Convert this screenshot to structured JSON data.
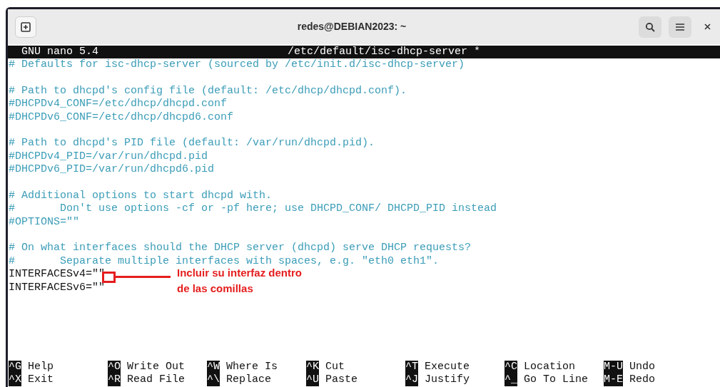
{
  "window": {
    "title": "redes@DEBIAN2023: ~"
  },
  "nano": {
    "version": "GNU nano 5.4",
    "filename": "/etc/default/isc-dhcp-server *"
  },
  "lines": [
    {
      "kind": "comment",
      "text": "# Defaults for isc-dhcp-server (sourced by /etc/init.d/isc-dhcp-server)"
    },
    {
      "kind": "blank"
    },
    {
      "kind": "comment",
      "text": "# Path to dhcpd's config file (default: /etc/dhcp/dhcpd.conf)."
    },
    {
      "kind": "comment",
      "text": "#DHCPDv4_CONF=/etc/dhcp/dhcpd.conf"
    },
    {
      "kind": "comment",
      "text": "#DHCPDv6_CONF=/etc/dhcp/dhcpd6.conf"
    },
    {
      "kind": "blank"
    },
    {
      "kind": "comment",
      "text": "# Path to dhcpd's PID file (default: /var/run/dhcpd.pid)."
    },
    {
      "kind": "comment",
      "text": "#DHCPDv4_PID=/var/run/dhcpd.pid"
    },
    {
      "kind": "comment",
      "text": "#DHCPDv6_PID=/var/run/dhcpd6.pid"
    },
    {
      "kind": "blank"
    },
    {
      "kind": "comment",
      "text": "# Additional options to start dhcpd with."
    },
    {
      "kind": "comment",
      "text": "#       Don't use options -cf or -pf here; use DHCPD_CONF/ DHCPD_PID instead"
    },
    {
      "kind": "comment",
      "text": "#OPTIONS=\"\""
    },
    {
      "kind": "blank"
    },
    {
      "kind": "comment",
      "text": "# On what interfaces should the DHCP server (dhcpd) serve DHCP requests?"
    },
    {
      "kind": "comment",
      "text": "#       Separate multiple interfaces with spaces, e.g. \"eth0 eth1\"."
    },
    {
      "kind": "code",
      "text": "INTERFACESv4=\"\""
    },
    {
      "kind": "code",
      "text": "INTERFACESv6=\"\""
    }
  ],
  "annotation": {
    "lines": [
      "Incluir su interfaz dentro",
      "de las comillas"
    ]
  },
  "shortcuts": [
    {
      "key": "^G",
      "label": "Help"
    },
    {
      "key": "^X",
      "label": "Exit"
    },
    {
      "key": "^O",
      "label": "Write Out"
    },
    {
      "key": "^R",
      "label": "Read File"
    },
    {
      "key": "^W",
      "label": "Where Is"
    },
    {
      "key": "^\\",
      "label": "Replace"
    },
    {
      "key": "^K",
      "label": "Cut"
    },
    {
      "key": "^U",
      "label": "Paste"
    },
    {
      "key": "^T",
      "label": "Execute"
    },
    {
      "key": "^J",
      "label": "Justify"
    },
    {
      "key": "^C",
      "label": "Location"
    },
    {
      "key": "^_",
      "label": "Go To Line"
    },
    {
      "key": "M-U",
      "label": "Undo"
    },
    {
      "key": "M-E",
      "label": "Redo"
    }
  ]
}
